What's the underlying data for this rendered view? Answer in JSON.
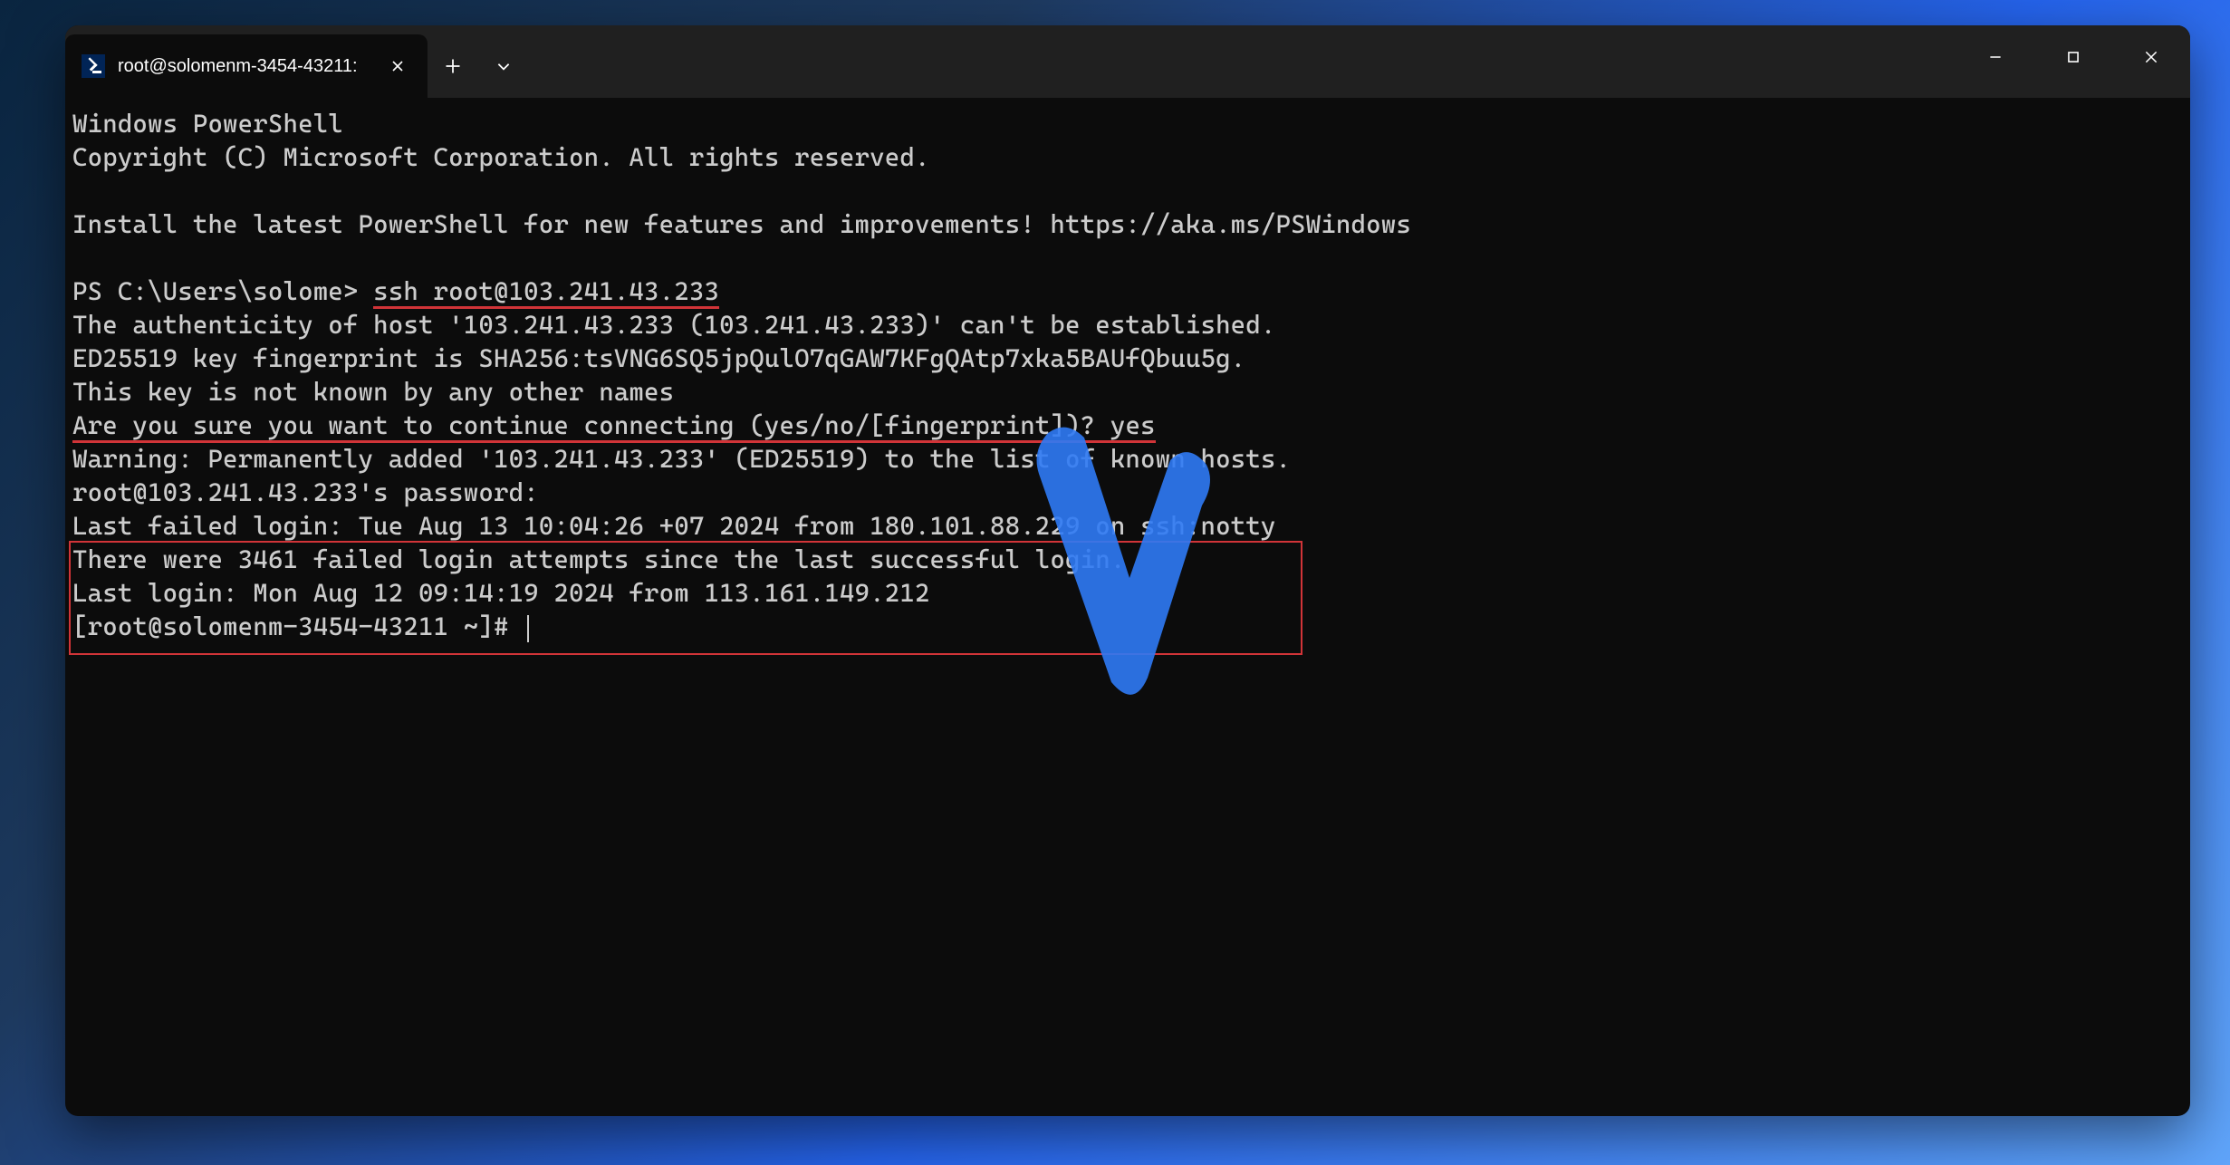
{
  "tab": {
    "title": "root@solomenm-3454-43211:"
  },
  "terminal": {
    "line1": "Windows PowerShell",
    "line2": "Copyright (C) Microsoft Corporation. All rights reserved.",
    "line3": "",
    "line4": "Install the latest PowerShell for new features and improvements! https://aka.ms/PSWindows",
    "line5": "",
    "prompt1_prefix": "PS C:\\Users\\solome> ",
    "prompt1_cmd": "ssh root@103.241.43.233",
    "line7": "The authenticity of host '103.241.43.233 (103.241.43.233)' can't be established.",
    "line8": "ED25519 key fingerprint is SHA256:tsVNG6SQ5jpQulO7qGAW7KFgQAtp7xka5BAUfQbuu5g.",
    "line9": "This key is not known by any other names",
    "line10_q": "Are you sure you want to continue connecting (yes/no/[fingerprint])?",
    "line10_ans": " yes",
    "line11": "Warning: Permanently added '103.241.43.233' (ED25519) to the list of known hosts.",
    "line12": "root@103.241.43.233's password:",
    "line13": "Last failed login: Tue Aug 13 10:04:26 +07 2024 from 180.101.88.229 on ssh:notty",
    "line14": "There were 3461 failed login attempts since the last successful login.",
    "line15": "Last login: Mon Aug 12 09:14:19 2024 from 113.161.149.212",
    "line16": "[root@solomenm-3454-43211 ~]# "
  },
  "annotations": {
    "underline1": {
      "target": "ssh root@103.241.43.233"
    },
    "underline2": {
      "target": "Are you sure you want to continue connecting (yes/no/[fingerprint])? yes"
    },
    "redbox": {
      "lines": [
        "line14",
        "line15",
        "line16"
      ]
    }
  },
  "colors": {
    "terminal_bg": "#0c0c0c",
    "titlebar_bg": "#202020",
    "text": "#cccccc",
    "annotation_red": "#d13438",
    "watermark_blue": "#2f7af5"
  }
}
